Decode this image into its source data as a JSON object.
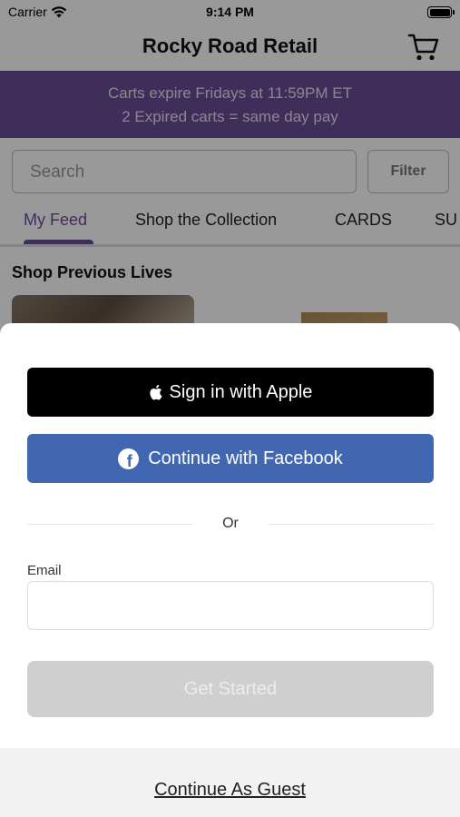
{
  "status_bar": {
    "carrier": "Carrier",
    "time": "9:14 PM"
  },
  "header": {
    "title": "Rocky Road Retail",
    "cart_icon": "cart-icon"
  },
  "banner": {
    "line1": "Carts expire Fridays at 11:59PM ET",
    "line2": "2 Expired carts = same day pay",
    "background_color": "#6b4d96"
  },
  "search": {
    "placeholder": "Search",
    "filter_label": "Filter"
  },
  "tabs": [
    {
      "label": "My Feed",
      "active": true
    },
    {
      "label": "Shop the Collection",
      "active": false
    },
    {
      "label": "CARDS",
      "active": false
    },
    {
      "label": "SU",
      "active": false
    }
  ],
  "feed": {
    "section_title": "Shop Previous Lives"
  },
  "auth_sheet": {
    "apple_label": "Sign in with Apple",
    "facebook_label": "Continue with Facebook",
    "facebook_color": "#4267b2",
    "divider_text": "Or",
    "email_label": "Email",
    "email_value": "",
    "email_placeholder": "",
    "get_started_label": "Get Started",
    "guest_label": "Continue As Guest"
  }
}
